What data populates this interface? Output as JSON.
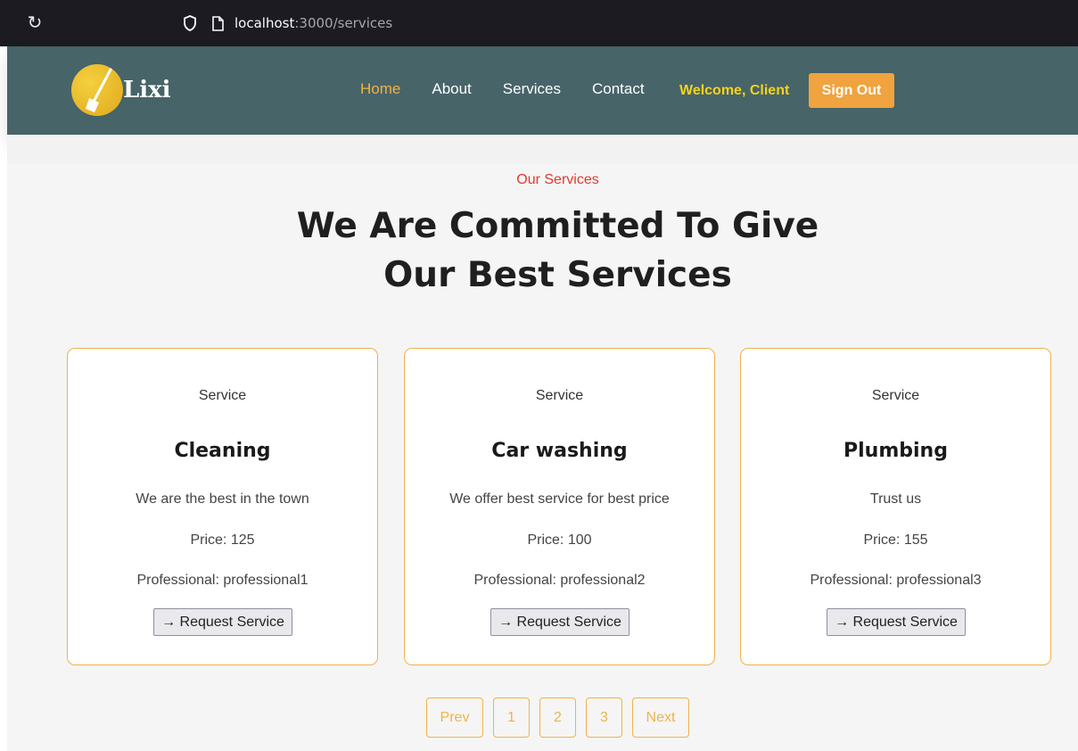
{
  "browser": {
    "url_host": "localhost",
    "url_path": ":3000/services"
  },
  "nav": {
    "logo_text": "Lixi",
    "links": [
      {
        "label": "Home",
        "active": true
      },
      {
        "label": "About",
        "active": false
      },
      {
        "label": "Services",
        "active": false
      },
      {
        "label": "Contact",
        "active": false
      }
    ],
    "welcome": "Welcome, Client",
    "signout_label": "Sign Out"
  },
  "hero": {
    "eyebrow": "Our Services",
    "headline_line1": "We Are Committed To Give",
    "headline_line2": "Our Best Services"
  },
  "services": [
    {
      "label": "Service",
      "title": "Cleaning",
      "description": "We are the best in the town",
      "price": "Price: 125",
      "professional": "Professional: professional1",
      "button": "Request Service"
    },
    {
      "label": "Service",
      "title": "Car washing",
      "description": "We offer best service for best price",
      "price": "Price: 100",
      "professional": "Professional: professional2",
      "button": "Request Service"
    },
    {
      "label": "Service",
      "title": "Plumbing",
      "description": "Trust us",
      "price": "Price: 155",
      "professional": "Professional: professional3",
      "button": "Request Service"
    }
  ],
  "pagination": {
    "prev": "Prev",
    "pages": [
      "1",
      "2",
      "3"
    ],
    "next": "Next"
  },
  "colors": {
    "nav_bg": "#476468",
    "accent": "#f0a33e",
    "active_link": "#f2b241",
    "welcome": "#f5d31a",
    "eyebrow": "#e03a2f"
  }
}
